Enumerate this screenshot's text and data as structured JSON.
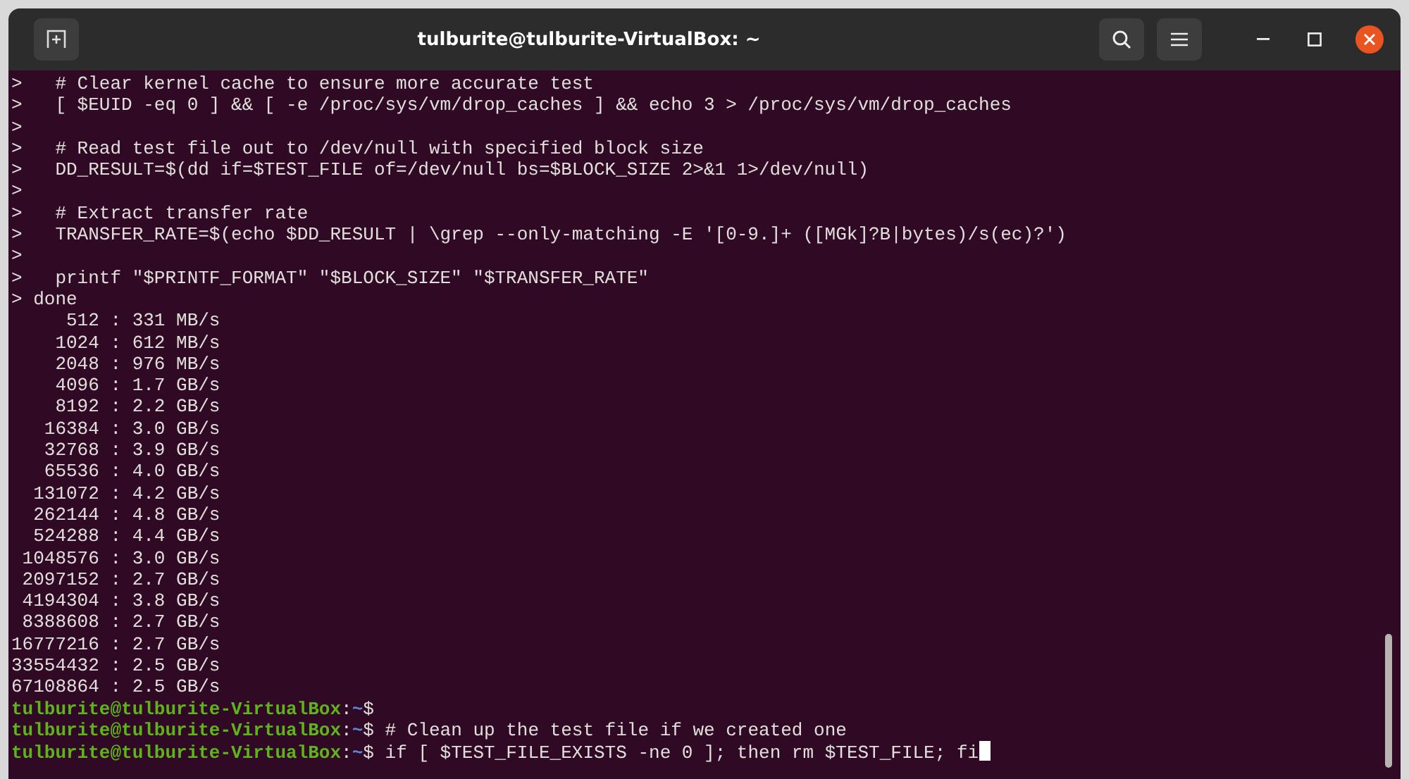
{
  "window": {
    "title": "tulburite@tulburite-VirtualBox: ~",
    "cursor_visible": true
  },
  "lines": [
    {
      "kind": "continuation",
      "text": ">   # Clear kernel cache to ensure more accurate test"
    },
    {
      "kind": "continuation",
      "text": ">   [ $EUID -eq 0 ] && [ -e /proc/sys/vm/drop_caches ] && echo 3 > /proc/sys/vm/drop_caches"
    },
    {
      "kind": "continuation",
      "text": ">"
    },
    {
      "kind": "continuation",
      "text": ">   # Read test file out to /dev/null with specified block size"
    },
    {
      "kind": "continuation",
      "text": ">   DD_RESULT=$(dd if=$TEST_FILE of=/dev/null bs=$BLOCK_SIZE 2>&1 1>/dev/null)"
    },
    {
      "kind": "continuation",
      "text": ">"
    },
    {
      "kind": "continuation",
      "text": ">   # Extract transfer rate"
    },
    {
      "kind": "continuation",
      "text": ">   TRANSFER_RATE=$(echo $DD_RESULT | \\grep --only-matching -E '[0-9.]+ ([MGk]?B|bytes)/s(ec)?')"
    },
    {
      "kind": "continuation",
      "text": ">"
    },
    {
      "kind": "continuation",
      "text": ">   printf \"$PRINTF_FORMAT\" \"$BLOCK_SIZE\" \"$TRANSFER_RATE\""
    },
    {
      "kind": "continuation",
      "text": "> done"
    },
    {
      "kind": "output",
      "text": "     512 : 331 MB/s"
    },
    {
      "kind": "output",
      "text": "    1024 : 612 MB/s"
    },
    {
      "kind": "output",
      "text": "    2048 : 976 MB/s"
    },
    {
      "kind": "output",
      "text": "    4096 : 1.7 GB/s"
    },
    {
      "kind": "output",
      "text": "    8192 : 2.2 GB/s"
    },
    {
      "kind": "output",
      "text": "   16384 : 3.0 GB/s"
    },
    {
      "kind": "output",
      "text": "   32768 : 3.9 GB/s"
    },
    {
      "kind": "output",
      "text": "   65536 : 4.0 GB/s"
    },
    {
      "kind": "output",
      "text": "  131072 : 4.2 GB/s"
    },
    {
      "kind": "output",
      "text": "  262144 : 4.8 GB/s"
    },
    {
      "kind": "output",
      "text": "  524288 : 4.4 GB/s"
    },
    {
      "kind": "output",
      "text": " 1048576 : 3.0 GB/s"
    },
    {
      "kind": "output",
      "text": " 2097152 : 2.7 GB/s"
    },
    {
      "kind": "output",
      "text": " 4194304 : 3.8 GB/s"
    },
    {
      "kind": "output",
      "text": " 8388608 : 2.7 GB/s"
    },
    {
      "kind": "output",
      "text": "16777216 : 2.7 GB/s"
    },
    {
      "kind": "output",
      "text": "33554432 : 2.5 GB/s"
    },
    {
      "kind": "output",
      "text": "67108864 : 2.5 GB/s"
    },
    {
      "kind": "prompt",
      "user_host": "tulburite@tulburite-VirtualBox",
      "separator": ":",
      "path": "~",
      "symbol": "$"
    },
    {
      "kind": "prompt",
      "user_host": "tulburite@tulburite-VirtualBox",
      "separator": ":",
      "path": "~",
      "symbol": "$",
      "command": " # Clean up the test file if we created one"
    },
    {
      "kind": "prompt",
      "user_host": "tulburite@tulburite-VirtualBox",
      "separator": ":",
      "path": "~",
      "symbol": "$",
      "command": " if [ $TEST_FILE_EXISTS -ne 0 ]; then rm $TEST_FILE; fi"
    }
  ]
}
